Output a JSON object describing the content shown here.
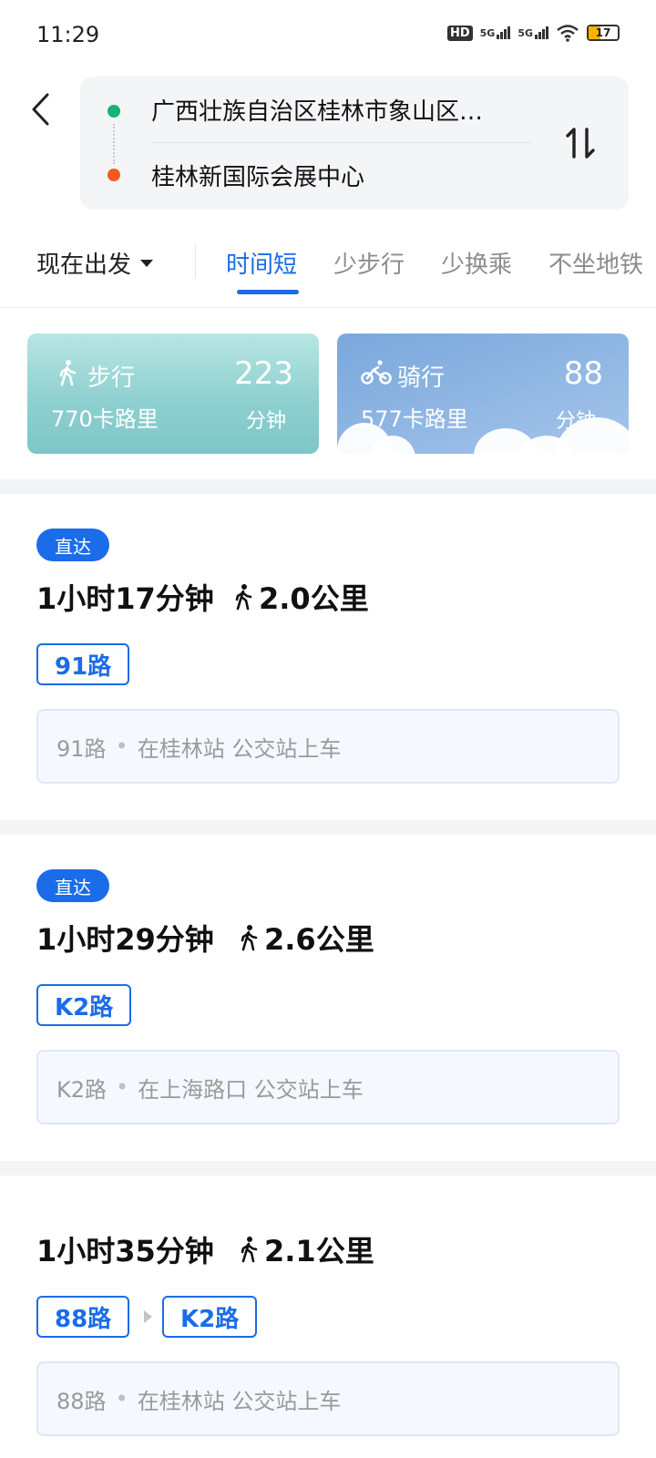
{
  "status": {
    "time": "11:29",
    "battery": "17",
    "hd": "HD",
    "network": "5G"
  },
  "route": {
    "origin": "广西壮族自治区桂林市象山区…",
    "destination": "桂林新国际会展中心"
  },
  "tabs": {
    "depart": "现在出发",
    "items": [
      "时间短",
      "少步行",
      "少换乘",
      "不坐地铁"
    ],
    "active": "时间短"
  },
  "modes": {
    "walk": {
      "label": "步行",
      "calories": "770卡路里",
      "minutes": "223",
      "unit": "分钟"
    },
    "bike": {
      "label": "骑行",
      "calories": "577卡路里",
      "minutes": "88",
      "unit": "分钟"
    }
  },
  "results": [
    {
      "badge": "直达",
      "duration": "1小时17分钟",
      "walk": "2.0公里",
      "lines": [
        "91路"
      ],
      "board_line": "91路",
      "board_text": "在桂林站 公交站上车"
    },
    {
      "badge": "直达",
      "duration": "1小时29分钟",
      "walk": "2.6公里",
      "lines": [
        "K2路"
      ],
      "board_line": "K2路",
      "board_text": "在上海路口 公交站上车"
    },
    {
      "badge": "",
      "duration": "1小时35分钟",
      "walk": "2.1公里",
      "lines": [
        "88路",
        "K2路"
      ],
      "board_line": "88路",
      "board_text": "在桂林站 公交站上车"
    }
  ],
  "colors": {
    "accent": "#1a6ce8",
    "origin_dot": "#16b374",
    "destination_dot": "#f55a1f"
  },
  "icons": [
    "back-icon",
    "swap-icon",
    "walk-icon",
    "bike-icon",
    "caret-down-icon"
  ]
}
